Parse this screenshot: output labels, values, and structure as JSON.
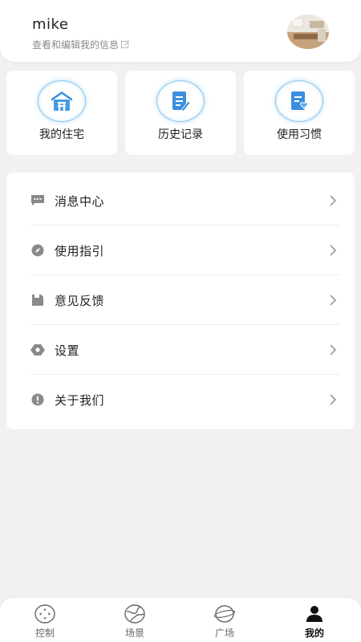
{
  "profile": {
    "username": "mike",
    "subtitle": "查看和编辑我的信息"
  },
  "tiles": [
    {
      "label": "我的住宅",
      "icon": "house-icon"
    },
    {
      "label": "历史记录",
      "icon": "history-document-icon"
    },
    {
      "label": "使用习惯",
      "icon": "habit-document-icon"
    }
  ],
  "menu": [
    {
      "label": "消息中心",
      "icon": "message-icon"
    },
    {
      "label": "使用指引",
      "icon": "compass-icon"
    },
    {
      "label": "意见反馈",
      "icon": "feedback-icon"
    },
    {
      "label": "设置",
      "icon": "settings-icon"
    },
    {
      "label": "关于我们",
      "icon": "info-icon"
    }
  ],
  "tabbar": [
    {
      "label": "控制",
      "icon": "control-icon",
      "active": false
    },
    {
      "label": "场景",
      "icon": "scene-icon",
      "active": false
    },
    {
      "label": "广场",
      "icon": "plaza-icon",
      "active": false
    },
    {
      "label": "我的",
      "icon": "profile-icon",
      "active": true
    }
  ],
  "colors": {
    "accent_blue": "#3b8fe0",
    "background": "#f1f1f2",
    "icon_gray": "#888888"
  }
}
